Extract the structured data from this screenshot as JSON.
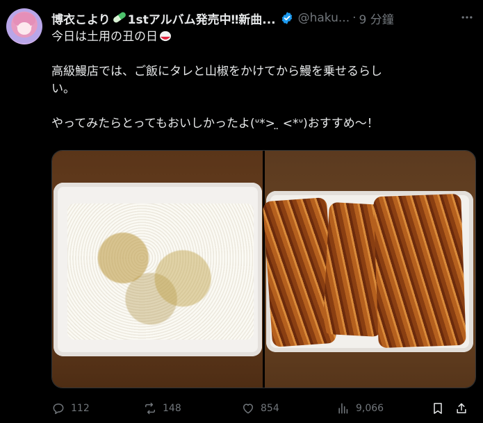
{
  "post": {
    "display_name": "博衣こより",
    "display_name_suffix": "1stアルバム発売中‼新曲...",
    "handle": "@haku...",
    "separator": "·",
    "timestamp": "9 分鐘",
    "lines": [
      "今日は土用の丑の日",
      "",
      "高級鰻店では、ご飯にタレと山椒をかけてから鰻を乗せるらし",
      "い。",
      "",
      "やってみたらとってもおいしかったよ(ᐡ*> ̤ <*ᐡ)おすすめ～！"
    ]
  },
  "stats": {
    "replies": "112",
    "reposts": "148",
    "likes": "854",
    "views": "9,066"
  },
  "icons": {
    "verified": "verified-badge-icon",
    "more": "more-icon",
    "reply": "reply-icon",
    "repost": "repost-icon",
    "like": "like-icon",
    "views": "views-icon",
    "bookmark": "bookmark-icon",
    "share": "share-icon"
  },
  "colors": {
    "background": "#000000",
    "text": "#e7e9ea",
    "muted": "#71767b",
    "verified": "#1d9bf0"
  }
}
